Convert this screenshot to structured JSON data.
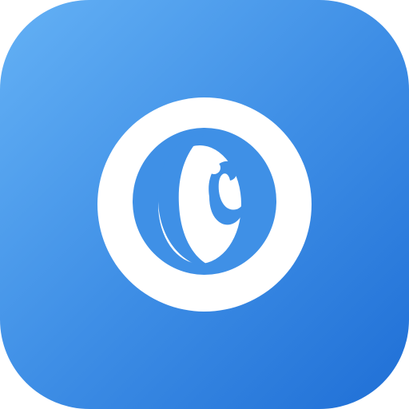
{
  "app_icon": {
    "glyph": "logo-mark-icon",
    "colors": {
      "gradient_start": "#64b1f5",
      "gradient_mid": "#3f8fe6",
      "gradient_end": "#1f6fd6",
      "mark": "#ffffff"
    }
  }
}
